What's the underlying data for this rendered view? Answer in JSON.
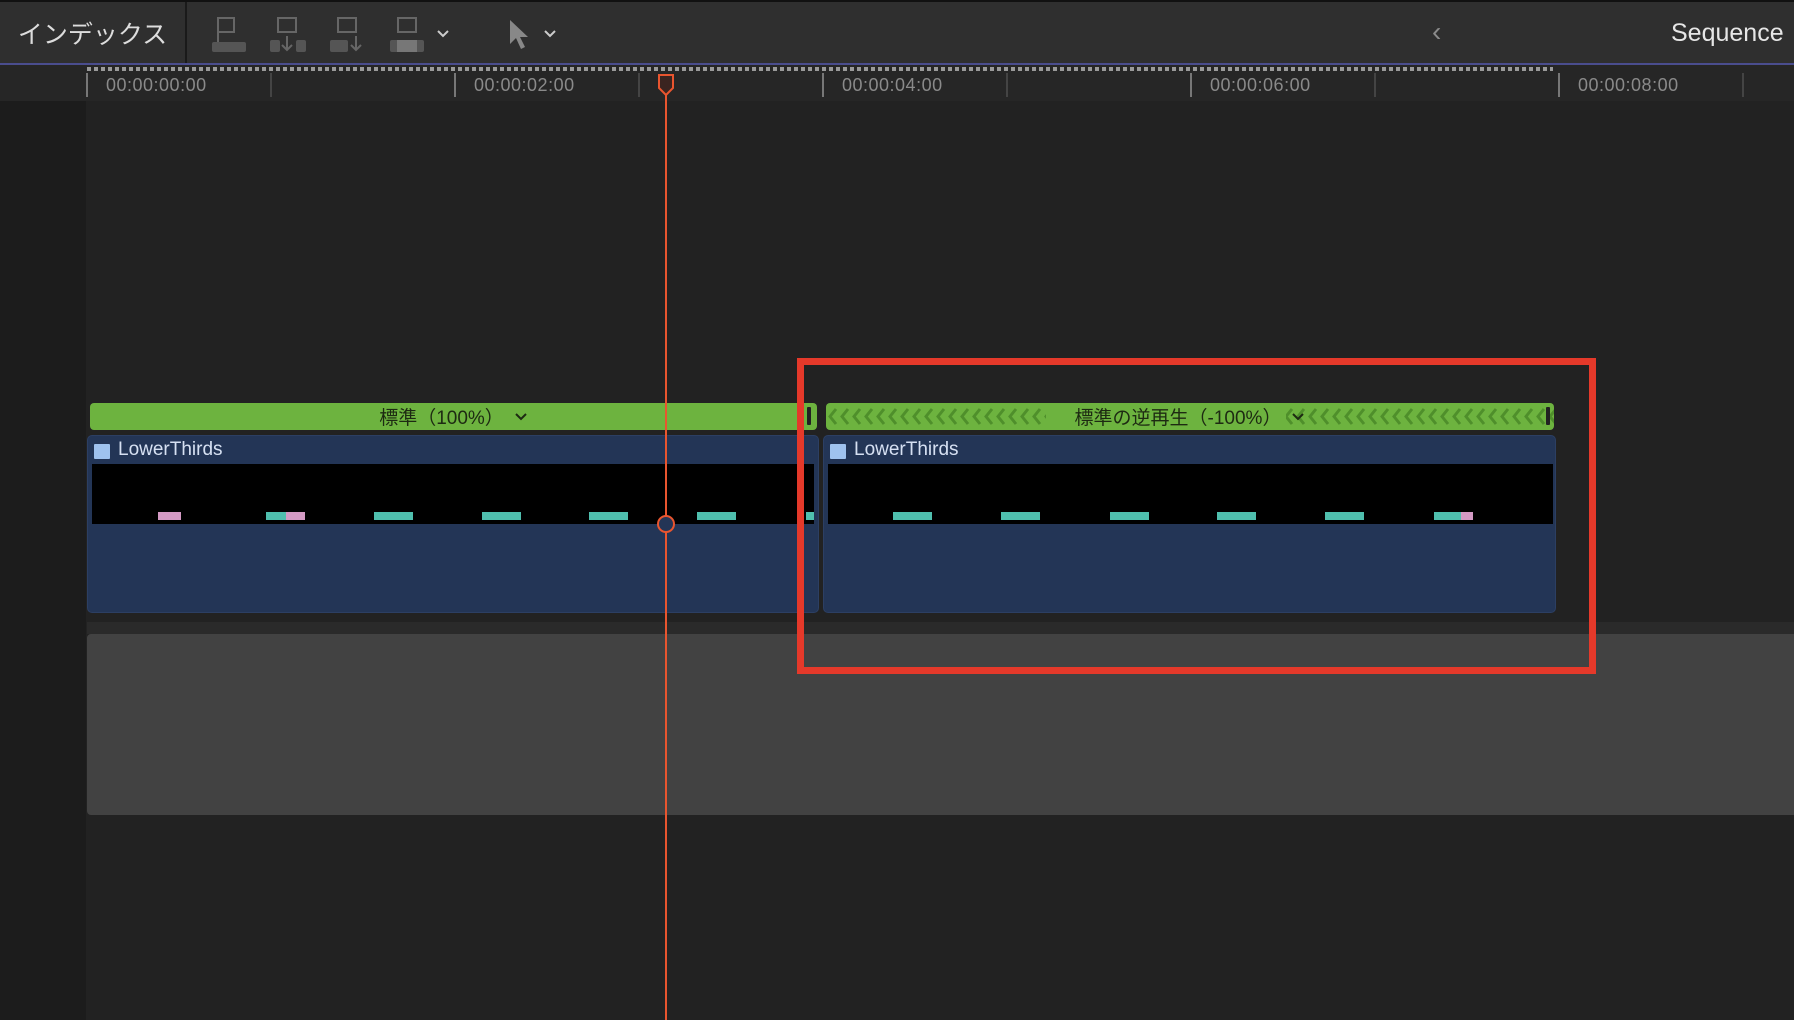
{
  "toolbar": {
    "index_label": "インデックス",
    "sequence_title": "Sequence",
    "back_icon": "chevron-left-icon"
  },
  "ruler": {
    "labels": [
      "00:00:00:00",
      "00:00:02:00",
      "00:00:04:00",
      "00:00:06:00",
      "00:00:08:00"
    ]
  },
  "clips": [
    {
      "name": "LowerThirds",
      "speed_label": "標準（100%）"
    },
    {
      "name": "LowerThirds",
      "speed_label": "標準の逆再生（-100%）"
    }
  ],
  "colors": {
    "playhead": "#e9552f",
    "speed_bar": "#6db33f",
    "clip": "#233556",
    "highlight": "#e5392a"
  }
}
